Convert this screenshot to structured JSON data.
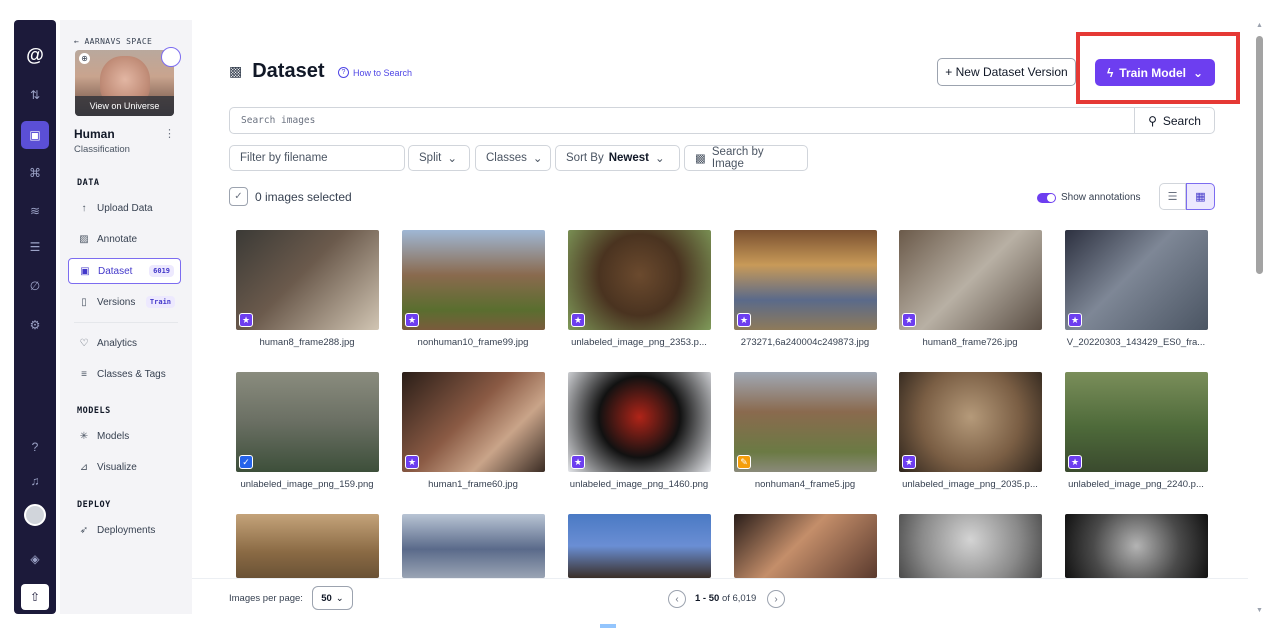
{
  "rail": {
    "logo": "@",
    "icons": [
      "swap-icon",
      "folder-icon",
      "workflow-icon",
      "chart-icon",
      "storage-icon",
      "brush-icon",
      "settings-icon",
      "help-icon",
      "bell-icon",
      "avatar",
      "cube-icon",
      "upload-icon"
    ]
  },
  "sidebar": {
    "back_label": "AARNAVS SPACE",
    "universe_label": "View on Universe",
    "project_name": "Human",
    "project_type": "Classification",
    "sections": {
      "data": "DATA",
      "models": "MODELS",
      "deploy": "DEPLOY"
    },
    "items": {
      "upload": "Upload Data",
      "annotate": "Annotate",
      "dataset": "Dataset",
      "dataset_badge": "6019",
      "versions": "Versions",
      "versions_badge": "Train",
      "analytics": "Analytics",
      "classes": "Classes & Tags",
      "models": "Models",
      "visualize": "Visualize",
      "deployments": "Deployments"
    }
  },
  "header": {
    "title": "Dataset",
    "how_to": "How to Search",
    "new_version": "+ New Dataset Version",
    "train_model": "Train Model"
  },
  "search": {
    "placeholder": "Search images",
    "button": "Search"
  },
  "filters": {
    "filename_placeholder": "Filter by filename",
    "split": "Split",
    "classes": "Classes",
    "sort_by": "Sort By",
    "sort_value": "Newest",
    "search_by_image": "Search by Image"
  },
  "selection": {
    "label": "0 images selected",
    "show_annotations": "Show annotations"
  },
  "images": [
    {
      "caption": "human8_frame288.jpg",
      "bg": "linear-gradient(135deg,#3b3a36 0%,#6b5a4c 45%,#d1c5b3 100%)",
      "tag": "run"
    },
    {
      "caption": "nonhuman10_frame99.jpg",
      "bg": "linear-gradient(180deg,#9fb7d4 0%,#8a6a4e 45%,#5a6e2f 80%,#7a5b3c 100%)",
      "tag": "run"
    },
    {
      "caption": "unlabeled_image_png_2353.p...",
      "bg": "radial-gradient(circle at 50% 45%,#6b4a2e 0%,#4a3320 45%,#7f9b5a 100%)",
      "tag": "run"
    },
    {
      "caption": "273271,6a240004c249873.jpg",
      "bg": "linear-gradient(180deg,#7a5030 0%,#c89a58 35%,#5a6a8a 70%,#8e7a5a 100%)",
      "tag": "run"
    },
    {
      "caption": "human8_frame726.jpg",
      "bg": "linear-gradient(135deg,#6b5a4a 0%,#b8b0a4 50%,#5a4e44 100%)",
      "tag": "run"
    },
    {
      "caption": "V_20220303_143429_ES0_fra...",
      "bg": "linear-gradient(135deg,#2d3140 0%,#7e8796 45%,#4b5563 100%)",
      "tag": "run"
    },
    {
      "caption": "unlabeled_image_png_159.png",
      "bg": "linear-gradient(180deg,#8a8c7e 0%,#6a6f63 50%,#3d4f3a 100%)",
      "tag": "shield"
    },
    {
      "caption": "human1_frame60.jpg",
      "bg": "linear-gradient(135deg,#2a1e18 0%,#8a5a44 45%,#c9a489 70%,#3a2c24 100%)",
      "tag": "run"
    },
    {
      "caption": "unlabeled_image_png_1460.png",
      "bg": "radial-gradient(circle at 50% 45%,#b02418 0%,#111111 45%,#e5e7eb 100%)",
      "tag": "run"
    },
    {
      "caption": "nonhuman4_frame5.jpg",
      "bg": "linear-gradient(180deg,#a0a8b4 0%,#8a6a4e 40%,#6b7a44 80%,#8a8a7a 100%)",
      "tag": "pencil"
    },
    {
      "caption": "unlabeled_image_png_2035.p...",
      "bg": "radial-gradient(circle at 50% 45%,#b59a7a 0%,#7a5e44 55%,#2d241c 100%)",
      "tag": "run"
    },
    {
      "caption": "unlabeled_image_png_2240.p...",
      "bg": "linear-gradient(180deg,#7a8e5a 0%,#4e6a3a 55%,#3a4a2e 100%)",
      "tag": "run"
    },
    {
      "caption": "",
      "bg": "linear-gradient(180deg,#c4a37a 0%,#8a6a44 60%,#6a5236 100%)",
      "tag": ""
    },
    {
      "caption": "",
      "bg": "linear-gradient(180deg,#b8c4d4 0%,#5a6a8a 55%,#9aa4b4 100%)",
      "tag": ""
    },
    {
      "caption": "",
      "bg": "linear-gradient(180deg,#4a7ac4 0%,#6a8ed4 50%,#3a2e28 100%)",
      "tag": ""
    },
    {
      "caption": "",
      "bg": "linear-gradient(135deg,#2a1e1a 0%,#c48e6a 45%,#5a3a2e 100%)",
      "tag": ""
    },
    {
      "caption": "",
      "bg": "radial-gradient(circle at 50% 40%,#d4d4d4 0%,#8a8a8a 60%,#4a4a4a 100%)",
      "tag": ""
    },
    {
      "caption": "",
      "bg": "radial-gradient(circle at 50% 50%,#b4b4b4 0%,#4a4a4a 55%,#111111 100%)",
      "tag": ""
    }
  ],
  "pagination": {
    "per_page_label": "Images per page:",
    "per_page_value": "50",
    "range": "1 - 50",
    "of_label": "of 6,019"
  }
}
